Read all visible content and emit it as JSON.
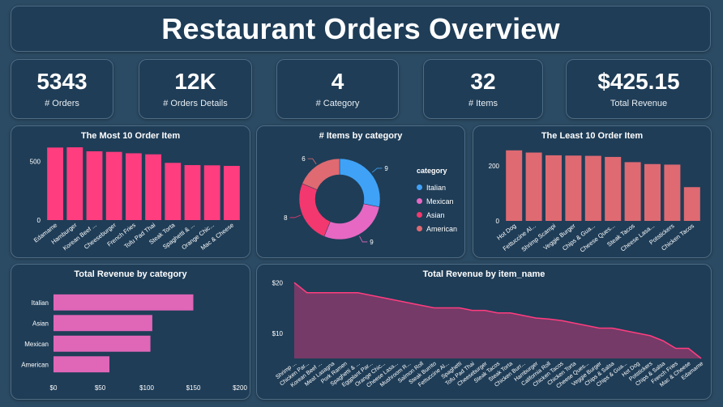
{
  "header": {
    "title": "Restaurant Orders Overview"
  },
  "kpis": [
    {
      "value": "5343",
      "label": "# Orders"
    },
    {
      "value": "12K",
      "label": "# Orders Details"
    },
    {
      "value": "4",
      "label": "# Category"
    },
    {
      "value": "32",
      "label": "# Items"
    },
    {
      "value": "$425.15",
      "label": "Total Revenue"
    }
  ],
  "colors": {
    "background": "#2b4a63",
    "panel": "#1f3d57",
    "most_bar": "#ff3d7f",
    "least_bar": "#df6a72",
    "revcat_bar": "#e066b8",
    "area_line": "#ff3d7f",
    "area_fill": "#7a3a68"
  },
  "chart_data": [
    {
      "type": "bar",
      "title": "The Most 10 Order Item",
      "categories": [
        "Edamame",
        "Hamburger",
        "Korean Beef ...",
        "Cheeseburger",
        "French Fries",
        "Tofu Pad Thai",
        "Steak Torta",
        "Spaghetti & ...",
        "Orange Chic...",
        "Mac & Cheese"
      ],
      "values": [
        620,
        622,
        588,
        583,
        571,
        562,
        489,
        470,
        468,
        463
      ],
      "yticks": [
        0,
        500
      ],
      "ylim": [
        0,
        650
      ]
    },
    {
      "type": "pie",
      "title": "# Items by category",
      "legend_title": "category",
      "categories": [
        "Italian",
        "Mexican",
        "Asian",
        "American"
      ],
      "values": [
        9,
        9,
        8,
        6
      ],
      "colors": [
        "#3fa2f7",
        "#e668c3",
        "#f2386e",
        "#df6a72"
      ]
    },
    {
      "type": "bar",
      "title": "The Least 10 Order Item",
      "categories": [
        "Hot Dog",
        "Fettuccine Al...",
        "Shrimp Scampi",
        "Veggie Burger",
        "Chips & Gua...",
        "Cheese Ques...",
        "Steak Tacos",
        "Cheese Lasa...",
        "Potstickers",
        "Chicken Tacos"
      ],
      "values": [
        257,
        249,
        239,
        238,
        237,
        233,
        214,
        207,
        205,
        123
      ],
      "yticks": [
        0,
        200
      ],
      "ylim": [
        0,
        280
      ]
    },
    {
      "type": "bar",
      "orientation": "horizontal",
      "title": "Total Revenue by category",
      "categories": [
        "Italian",
        "Asian",
        "Mexican",
        "American"
      ],
      "values": [
        150,
        106,
        104,
        60
      ],
      "xticks": [
        "$0",
        "$50",
        "$100",
        "$150",
        "$200"
      ],
      "xlim": [
        0,
        200
      ]
    },
    {
      "type": "area",
      "title": "Total Revenue by item_name",
      "x": [
        "Shrimp ...",
        "Chicken Par...",
        "Korean Beef ...",
        "Meat Lasagna",
        "Pork Ramen",
        "Spaghetti & ...",
        "Eggplant Par...",
        "Orange Chic...",
        "Cheese Lasa...",
        "Mushroom R...",
        "Salmon Roll",
        "Steak Burrito",
        "Fettuccine Al...",
        "Spaghetti",
        "Tofu Pad Thai",
        "Cheeseburger",
        "Steak Tacos",
        "Steak Torta",
        "Chicken Burr...",
        "Hamburger",
        "California Roll",
        "Chicken Tacos",
        "Chicken Torta",
        "Cheese Ques...",
        "Veggie Burger",
        "Chips & Salsa",
        "Chips & Gua...",
        "Hot Dog",
        "Potstickers",
        "Chips & Salsa",
        "French Fries",
        "Mac & Cheese",
        "Edamame"
      ],
      "values": [
        20,
        18,
        18,
        18,
        18,
        18,
        17.5,
        17,
        16.5,
        16,
        15.5,
        15,
        15,
        15,
        14.5,
        14.5,
        14,
        14,
        13.5,
        13,
        12.8,
        12.5,
        12,
        11.5,
        11,
        11,
        10.5,
        10,
        9.5,
        8.5,
        7,
        7,
        5
      ],
      "yticks": [
        "$10",
        "$20"
      ],
      "ylim": [
        5,
        21
      ]
    }
  ]
}
